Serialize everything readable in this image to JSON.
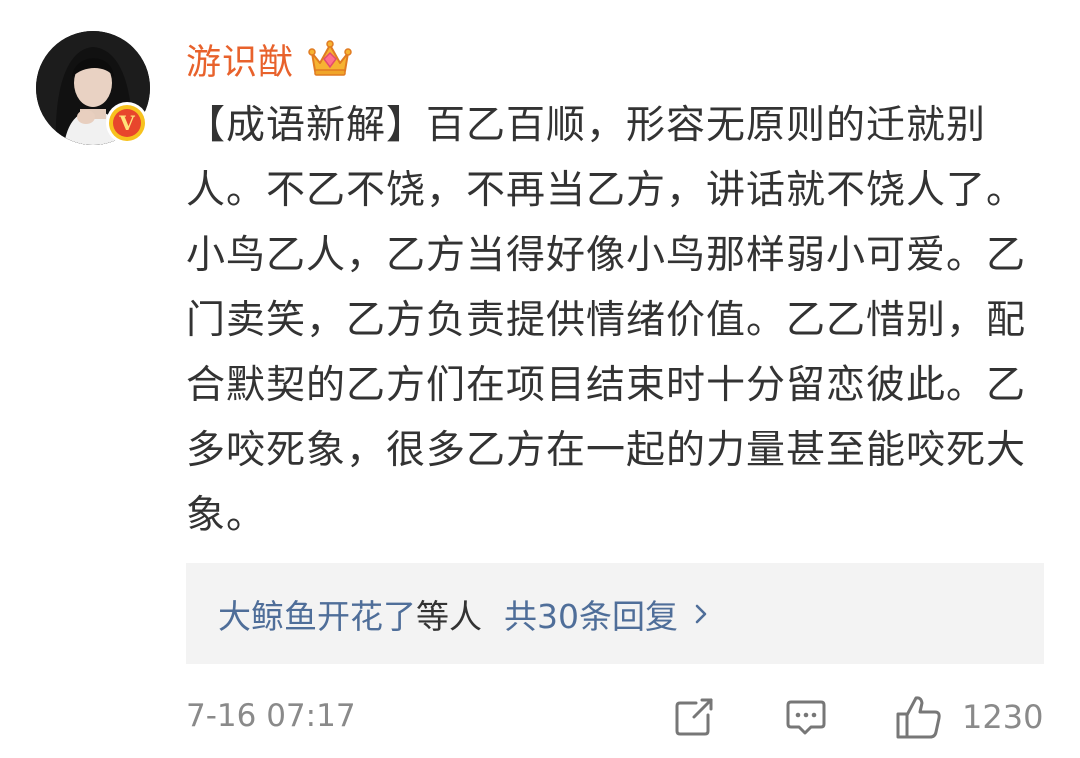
{
  "comment": {
    "username": "游识猷",
    "crown_icon": "crown-icon",
    "verify_icon": "verified-badge-icon",
    "verify_letter": "V",
    "text": "【成语新解】百乙百顺，形容无原则的迁就别人。不乙不饶，不再当乙方，讲话就不饶人了。小鸟乙人，乙方当得好像小鸟那样弱小可爱。乙门卖笑，乙方负责提供情绪价值。乙乙惜别，配合默契的乙方们在项目结束时十分留恋彼此。乙多咬死象，很多乙方在一起的力量甚至能咬死大象。",
    "replies": {
      "names": "大鲸鱼开花了",
      "suffix": "等人",
      "count_label": "共30条回复"
    },
    "timestamp": "7-16 07:17",
    "like_count": "1230"
  },
  "colors": {
    "username": "#e8622c",
    "link": "#4f6e99",
    "text": "#333333",
    "meta": "#8a8a8a",
    "reply_bg": "#f3f3f3"
  }
}
